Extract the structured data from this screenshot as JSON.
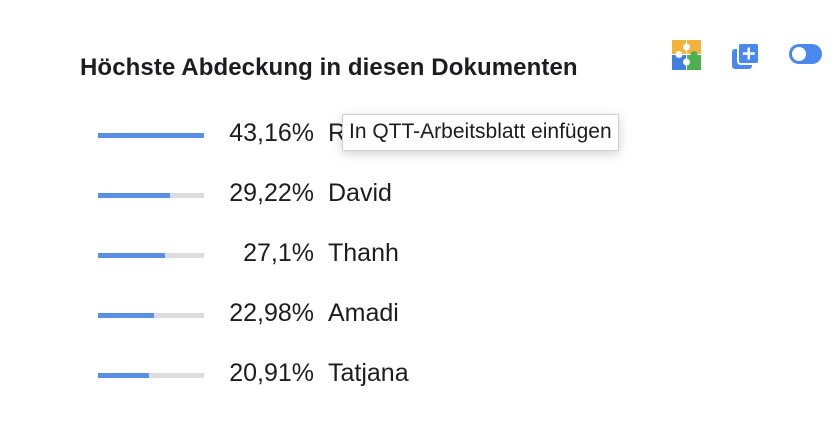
{
  "title": "Höchste Abdeckung in diesen Dokumenten",
  "toolbar": {
    "puzzle_icon": "puzzle-icon",
    "copy_icon": "add-copy-icon",
    "toggle_on": true,
    "accent_color": "#4a88f0"
  },
  "rows": [
    {
      "percent_label": "43,16%",
      "percent": 43.16,
      "name": "R"
    },
    {
      "percent_label": "29,22%",
      "percent": 29.22,
      "name": "David"
    },
    {
      "percent_label": "27,1%",
      "percent": 27.1,
      "name": "Thanh"
    },
    {
      "percent_label": "22,98%",
      "percent": 22.98,
      "name": "Amadi"
    },
    {
      "percent_label": "20,91%",
      "percent": 20.91,
      "name": "Tatjana"
    }
  ],
  "tooltip": {
    "text": "In QTT-Arbeitsblatt einfügen"
  }
}
